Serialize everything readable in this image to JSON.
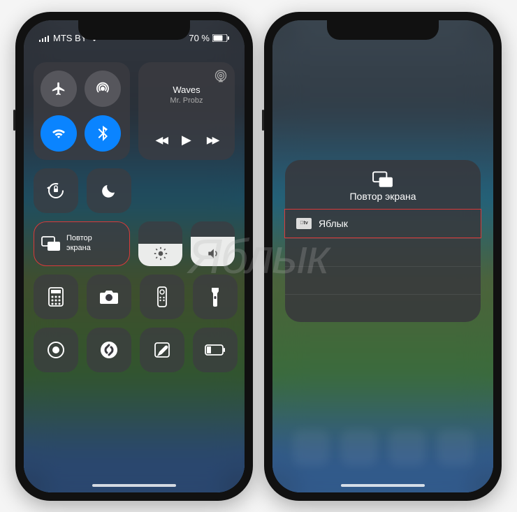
{
  "watermark": "Яблык",
  "status": {
    "carrier": "MTS BY",
    "battery_text": "70 %"
  },
  "connectivity": {
    "airplane": "airplane-icon",
    "airdrop": "airdrop-icon",
    "wifi": "wifi-icon",
    "bluetooth": "bluetooth-icon"
  },
  "music": {
    "track": "Waves",
    "artist": "Mr. Probz",
    "prev": "◀◀",
    "play": "▶",
    "next": "▶▶"
  },
  "toggles": {
    "lock": "rotation-lock-icon",
    "dnd": "moon-icon"
  },
  "mirror": {
    "label_line1": "Повтор",
    "label_line2": "экрана"
  },
  "sliders": {
    "brightness_pct": 50,
    "volume_pct": 65
  },
  "shortcuts": [
    "calculator-icon",
    "camera-icon",
    "remote-icon",
    "flashlight-icon",
    "record-icon",
    "shazam-icon",
    "note-icon",
    "low-power-icon"
  ],
  "panel": {
    "title": "Повтор экрана",
    "devices": [
      {
        "name": "Яблык",
        "type": "apple-tv"
      }
    ]
  },
  "colors": {
    "active_blue": "#0a84ff",
    "highlight_red": "#d93a3a"
  }
}
